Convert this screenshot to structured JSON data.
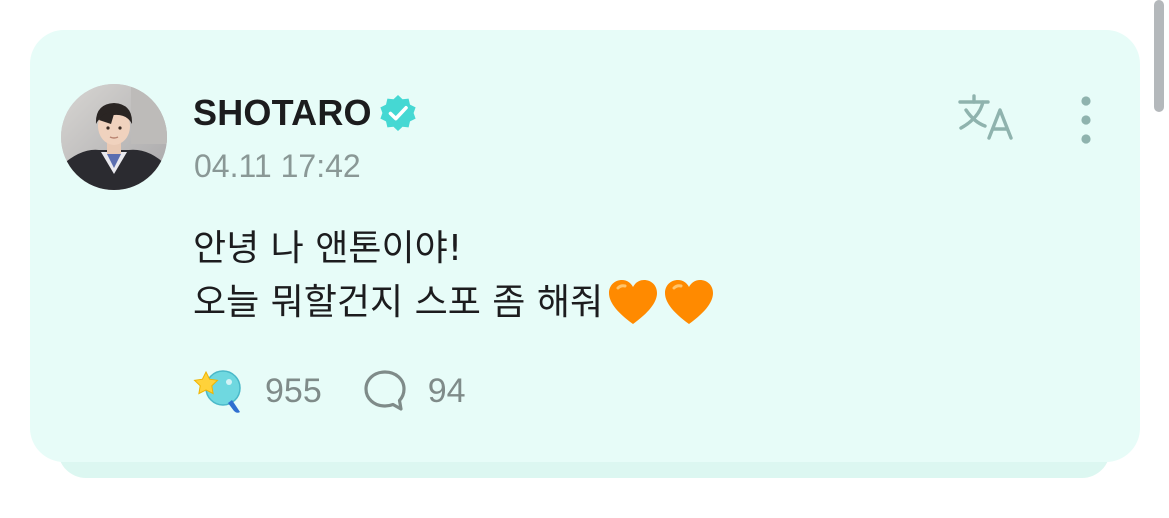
{
  "post": {
    "author": "SHOTARO",
    "verified": true,
    "timestamp": "04.11 17:42",
    "body_lines": [
      "안녕 나 앤톤이야!",
      "오늘 뭐할건지 스포 좀 해줘"
    ],
    "trailing_emoji": [
      "orange-heart-emoji",
      "orange-heart-emoji"
    ],
    "likes_count": "955",
    "comments_count": "94"
  },
  "icons": {
    "verified": "verified-check-icon",
    "translate": "translate-icon",
    "more": "more-vertical-icon",
    "like": "star-bubble-like-icon",
    "comment": "comment-bubble-icon"
  },
  "colors": {
    "card_background": "#e7fcf8",
    "accent_teal": "#45d8d3",
    "heart_orange": "#ff8a00",
    "muted_text": "#8a9896"
  }
}
